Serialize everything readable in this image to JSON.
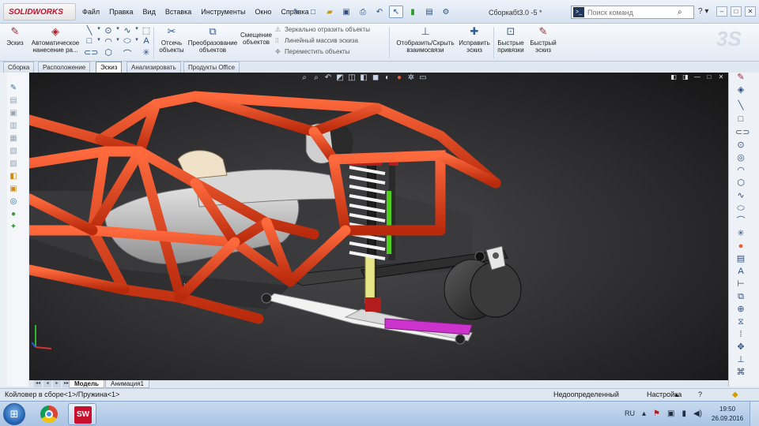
{
  "app": {
    "logo_text": "SOLIDWORKS",
    "document_title": "Сборкабt3.0 -5 *"
  },
  "menu": {
    "items": [
      "Файл",
      "Правка",
      "Вид",
      "Вставка",
      "Инструменты",
      "Окно",
      "Справка"
    ]
  },
  "search": {
    "placeholder": "Поиск команд"
  },
  "ribbon": {
    "sketch_label": "Эскиз",
    "auto_dim_label_1": "Автоматическое",
    "auto_dim_label_2": "нанесение ра...",
    "trim_label_1": "Отсечь",
    "trim_label_2": "объекты",
    "convert_label_1": "Преобразование",
    "convert_label_2": "объектов",
    "offset_label_1": "Смещение",
    "offset_label_2": "объектов",
    "mirror_label": "Зеркально отразить объекты",
    "linear_pattern_label": "Линейный массив эскиза",
    "move_label": "Переместить объекты",
    "show_relations_label_1": "Отобразить/Скрыть",
    "show_relations_label_2": "взаимосвязи",
    "repair_label_1": "Исправить",
    "repair_label_2": "эскиз",
    "quick_snaps_label_1": "Быстрые",
    "quick_snaps_label_2": "привязки",
    "rapid_sketch_label_1": "Быстрый",
    "rapid_sketch_label_2": "эскиз"
  },
  "tabs": [
    "Сборка",
    "Расположение",
    "Эскиз",
    "Анализировать",
    "Продукты Office"
  ],
  "active_tab": "Эскиз",
  "bottom_tabs": [
    "Модель",
    "Анимация1"
  ],
  "status": {
    "left": "Койловер в сборе<1>/Пружина<1>",
    "state": "Недоопределенный",
    "mode": "Настройка"
  },
  "taskbar": {
    "language": "RU",
    "time": "19:50",
    "date": "26.09.2016"
  },
  "colors": {
    "frame_tube": "#e8401c",
    "viewport_bg": "#2b2b2d",
    "accent": "#2f5d96",
    "brand_red": "#c8102e"
  },
  "icons": [
    "search-icon",
    "help-icon",
    "minimize-icon",
    "maximize-icon",
    "close-icon",
    "start-orb-icon",
    "chrome-icon",
    "solidworks-icon"
  ]
}
